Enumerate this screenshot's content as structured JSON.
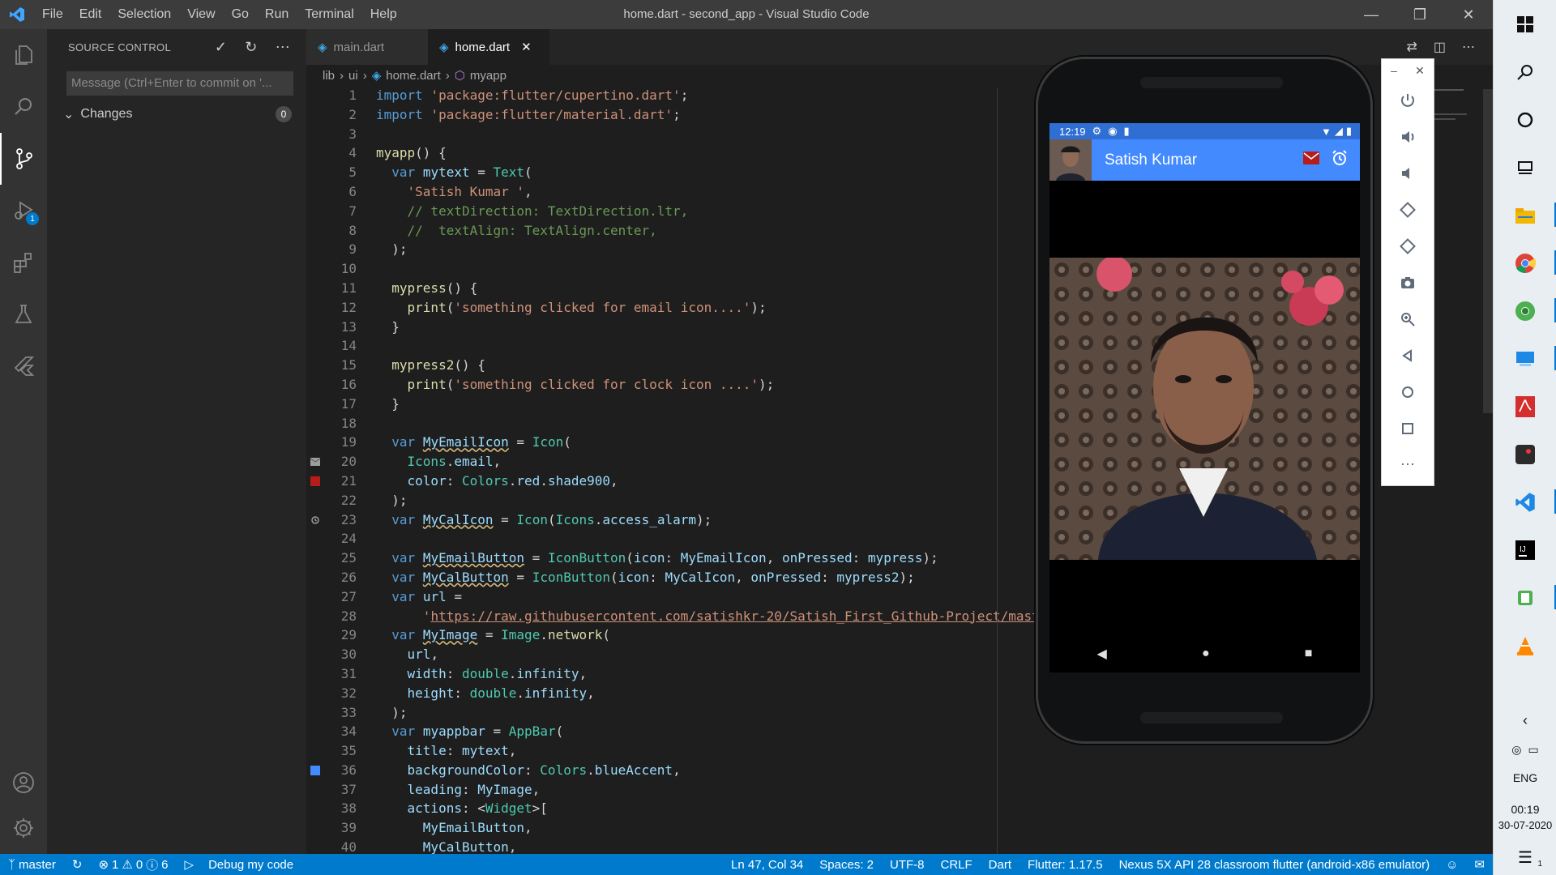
{
  "window": {
    "title": "home.dart - second_app - Visual Studio Code",
    "menu": [
      "File",
      "Edit",
      "Selection",
      "View",
      "Go",
      "Run",
      "Terminal",
      "Help"
    ]
  },
  "activity_bar": {
    "items": [
      "explorer-icon",
      "search-icon",
      "source-control-icon",
      "run-debug-icon",
      "extensions-icon",
      "testing-icon",
      "flutter-icon"
    ],
    "debug_badge": "1",
    "bottom": [
      "accounts-icon",
      "settings-gear-icon"
    ]
  },
  "sidebar": {
    "title": "SOURCE CONTROL",
    "message_placeholder": "Message (Ctrl+Enter to commit on '...",
    "changes_label": "Changes",
    "changes_count": "0"
  },
  "tabs": [
    {
      "label": "main.dart",
      "active": false
    },
    {
      "label": "home.dart",
      "active": true
    }
  ],
  "breadcrumb": [
    "lib",
    "ui",
    "home.dart",
    "myapp"
  ],
  "code_lines": [
    {
      "n": "1",
      "html": "<span class='k'>import</span> <span class='s'>'package:flutter/cupertino.dart'</span>;"
    },
    {
      "n": "2",
      "html": "<span class='k'>import</span> <span class='s'>'package:flutter/material.dart'</span>;"
    },
    {
      "n": "3",
      "html": ""
    },
    {
      "n": "4",
      "html": "<span class='f'>myapp</span>() {"
    },
    {
      "n": "5",
      "html": "  <span class='k'>var</span> <span class='v'>mytext</span> = <span class='t'>Text</span>("
    },
    {
      "n": "6",
      "html": "    <span class='s'>'Satish Kumar '</span>,"
    },
    {
      "n": "7",
      "html": "    <span class='c'>// textDirection: TextDirection.ltr,</span>"
    },
    {
      "n": "8",
      "html": "    <span class='c'>//  textAlign: TextAlign.center,</span>"
    },
    {
      "n": "9",
      "html": "  );"
    },
    {
      "n": "10",
      "html": ""
    },
    {
      "n": "11",
      "html": "  <span class='f'>mypress</span>() {"
    },
    {
      "n": "12",
      "html": "    <span class='f'>print</span>(<span class='s'>'something clicked for email icon....'</span>);"
    },
    {
      "n": "13",
      "html": "  }"
    },
    {
      "n": "14",
      "html": ""
    },
    {
      "n": "15",
      "html": "  <span class='f'>mypress2</span>() {"
    },
    {
      "n": "16",
      "html": "    <span class='f'>print</span>(<span class='s'>'something clicked for clock icon ....'</span>);"
    },
    {
      "n": "17",
      "html": "  }"
    },
    {
      "n": "18",
      "html": ""
    },
    {
      "n": "19",
      "html": "  <span class='k'>var</span> <span class='v sq'>MyEmailIcon</span> = <span class='t'>Icon</span>("
    },
    {
      "n": "20",
      "html": "    <span class='t'>Icons</span>.<span class='v'>email</span>,"
    },
    {
      "n": "21",
      "html": "    <span class='v'>color</span>: <span class='t'>Colors</span>.<span class='v'>red</span>.<span class='v'>shade900</span>,"
    },
    {
      "n": "22",
      "html": "  );"
    },
    {
      "n": "23",
      "html": "  <span class='k'>var</span> <span class='v sq'>MyCalIcon</span> = <span class='t'>Icon</span>(<span class='t'>Icons</span>.<span class='v'>access_alarm</span>);"
    },
    {
      "n": "24",
      "html": ""
    },
    {
      "n": "25",
      "html": "  <span class='k'>var</span> <span class='v sq'>MyEmailButton</span> = <span class='t'>IconButton</span>(<span class='v'>icon</span>: <span class='v'>MyEmailIcon</span>, <span class='v'>onPressed</span>: <span class='v'>mypress</span>);"
    },
    {
      "n": "26",
      "html": "  <span class='k'>var</span> <span class='v sq'>MyCalButton</span> = <span class='t'>IconButton</span>(<span class='v'>icon</span>: <span class='v'>MyCalIcon</span>, <span class='v'>onPressed</span>: <span class='v'>mypress2</span>);"
    },
    {
      "n": "27",
      "html": "  <span class='k'>var</span> <span class='v'>url</span> ="
    },
    {
      "n": "28",
      "html": "      <span class='s'>'</span><span class='url'>https://raw.githubusercontent.com/satishkr-20/Satish_First_Github-Project/mast</span>"
    },
    {
      "n": "29",
      "html": "  <span class='k'>var</span> <span class='v sq'>MyImage</span> = <span class='t'>Image</span>.<span class='f'>network</span>("
    },
    {
      "n": "30",
      "html": "    <span class='v'>url</span>,"
    },
    {
      "n": "31",
      "html": "    <span class='v'>width</span>: <span class='t'>double</span>.<span class='v'>infinity</span>,"
    },
    {
      "n": "32",
      "html": "    <span class='v'>height</span>: <span class='t'>double</span>.<span class='v'>infinity</span>,"
    },
    {
      "n": "33",
      "html": "  );"
    },
    {
      "n": "34",
      "html": "  <span class='k'>var</span> <span class='v'>myappbar</span> = <span class='t'>AppBar</span>("
    },
    {
      "n": "35",
      "html": "    <span class='v'>title</span>: <span class='v'>mytext</span>,"
    },
    {
      "n": "36",
      "html": "    <span class='v'>backgroundColor</span>: <span class='t'>Colors</span>.<span class='v'>blueAccent</span>,"
    },
    {
      "n": "37",
      "html": "    <span class='v'>leading</span>: <span class='v'>MyImage</span>,"
    },
    {
      "n": "38",
      "html": "    <span class='v'>actions</span>: &lt;<span class='t'>Widget</span>&gt;["
    },
    {
      "n": "39",
      "html": "      <span class='v'>MyEmailButton</span>,"
    },
    {
      "n": "40",
      "html": "      <span class='v'>MyCalButton</span>,"
    }
  ],
  "gutter_markers": {
    "20": "email-icon",
    "21": "red-color-swatch",
    "23": "alarm-icon",
    "36": "blue-color-swatch"
  },
  "status_bar": {
    "branch": "master",
    "errors": "1",
    "warnings": "0",
    "infos": "6",
    "debug": "Debug my code",
    "position": "Ln 47, Col 34",
    "spaces": "Spaces: 2",
    "encoding": "UTF-8",
    "eol": "CRLF",
    "language": "Dart",
    "flutter": "Flutter: 1.17.5",
    "device": "Nexus 5X API 28 classroom flutter (android-x86 emulator)"
  },
  "emulator": {
    "status_time": "12:19",
    "app_title": "Satish Kumar",
    "colors": {
      "appbar": "#448aff",
      "statusbar": "#2f6fd3",
      "email_icon": "#b71c1c"
    },
    "panel_buttons": [
      "power-icon",
      "volume-up-icon",
      "volume-down-icon",
      "rotate-left-icon",
      "rotate-right-icon",
      "camera-icon",
      "zoom-icon",
      "back-icon",
      "home-icon",
      "overview-icon",
      "more-icon"
    ]
  },
  "taskbar": {
    "apps": [
      "windows-start-icon",
      "search-icon",
      "cortana-icon",
      "task-view-icon",
      "file-explorer-icon",
      "chrome-icon",
      "chrome-canary-icon",
      "device-icon",
      "pdf-icon",
      "app-icon",
      "vscode-icon",
      "intellij-icon",
      "android-emulator-icon",
      "vlc-icon"
    ],
    "lang": "ENG",
    "time": "00:19",
    "date": "30-07-2020",
    "notification_count": "1"
  }
}
